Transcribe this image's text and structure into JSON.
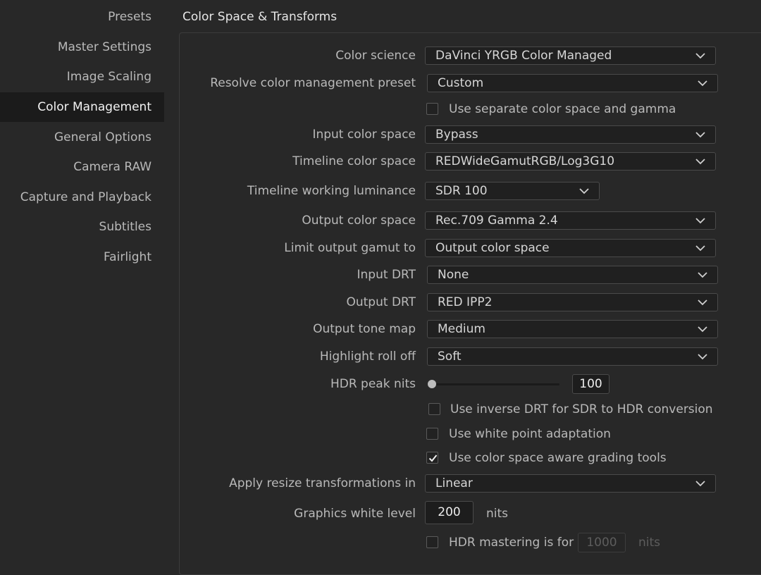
{
  "sidebar": {
    "items": [
      {
        "label": "Presets"
      },
      {
        "label": "Master Settings"
      },
      {
        "label": "Image Scaling"
      },
      {
        "label": "Color Management",
        "active": true
      },
      {
        "label": "General Options"
      },
      {
        "label": "Camera RAW"
      },
      {
        "label": "Capture and Playback"
      },
      {
        "label": "Subtitles"
      },
      {
        "label": "Fairlight"
      }
    ]
  },
  "section": {
    "title": "Color Space & Transforms"
  },
  "fields": {
    "color_science": {
      "label": "Color science",
      "value": "DaVinci YRGB Color Managed"
    },
    "cm_preset": {
      "label": "Resolve color management preset",
      "value": "Custom"
    },
    "separate_cs_gamma": {
      "label": "Use separate color space and gamma",
      "checked": false
    },
    "input_cs": {
      "label": "Input color space",
      "value": "Bypass"
    },
    "timeline_cs": {
      "label": "Timeline color space",
      "value": "REDWideGamutRGB/Log3G10"
    },
    "timeline_lum": {
      "label": "Timeline working luminance",
      "value": "SDR 100"
    },
    "output_cs": {
      "label": "Output color space",
      "value": "Rec.709 Gamma 2.4"
    },
    "limit_gamut": {
      "label": "Limit output gamut to",
      "value": "Output color space"
    },
    "input_drt": {
      "label": "Input DRT",
      "value": "None"
    },
    "output_drt": {
      "label": "Output DRT",
      "value": "RED IPP2"
    },
    "tone_map": {
      "label": "Output tone map",
      "value": "Medium"
    },
    "roll_off": {
      "label": "Highlight roll off",
      "value": "Soft"
    },
    "hdr_peak": {
      "label": "HDR peak nits",
      "value": "100",
      "slider_fraction": 0.0
    },
    "inverse_drt": {
      "label": "Use inverse DRT for SDR to HDR conversion",
      "checked": false
    },
    "white_point": {
      "label": "Use white point adaptation",
      "checked": false
    },
    "aware_grading": {
      "label": "Use color space aware grading tools",
      "checked": true
    },
    "resize_in": {
      "label": "Apply resize transformations in",
      "value": "Linear"
    },
    "graphics_white": {
      "label": "Graphics white level",
      "value": "200",
      "unit": "nits"
    },
    "hdr_mastering": {
      "label": "HDR mastering is for",
      "value": "1000",
      "unit": "nits",
      "checked": false,
      "disabled": true
    }
  },
  "colors": {
    "background": "#282828",
    "sidebar_active": "#1b1b1b",
    "field_bg": "#202020"
  },
  "icons": {
    "dropdown": "chevron-down-icon",
    "check": "checkmark-icon"
  }
}
